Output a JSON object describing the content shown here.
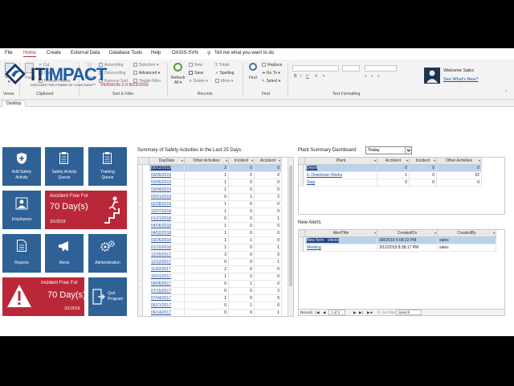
{
  "menu": {
    "file": "File",
    "home": "Home",
    "create": "Create",
    "external": "External Data",
    "database": "Database Tools",
    "help": "Help",
    "oasis": "OASIS-SVN",
    "tellme": "Tell me what you want to do"
  },
  "ribbon": {
    "view": "View",
    "paste": "Paste",
    "cut": "Cut",
    "copy": "Copy",
    "format_painter": "Format Painter",
    "filter": "Filter",
    "ascending": "Ascending",
    "descending": "Descending",
    "remove_sort": "Remove Sort",
    "selection": "Selection",
    "advanced": "Advanced",
    "toggle_filter": "Toggle Filter",
    "refresh": "Refresh",
    "refresh_all": "All",
    "new": "New",
    "save": "Save",
    "delete": "Delete",
    "totals": "Totals",
    "spelling": "Spelling",
    "more": "More",
    "find": "Find",
    "replace": "Replace",
    "goto": "Go To",
    "select": "Select",
    "groups": {
      "views": "Views",
      "clipboard": "Clipboard",
      "sort_filter": "Sort & Filter",
      "records": "Records",
      "find": "Find",
      "text_formatting": "Text Formatting"
    }
  },
  "tab": {
    "desktop": "Desktop"
  },
  "header": {
    "logo_it": "IT",
    "logo_impact": "IMPACT",
    "tagline": "DISCOVER THE POWER OF YOUR DATA™",
    "version": "VERSION 2.0 8/23/2016",
    "welcome": "Welcome Sales",
    "whats_new": "See What's New?"
  },
  "tiles": {
    "add_safety_1": "Add Safety",
    "add_safety_2": "Activity",
    "safety_queue_1": "Safety Activity",
    "safety_queue_2": "Queue",
    "training_1": "Training",
    "training_2": "Queue",
    "employees": "Employees",
    "reports": "Reports",
    "alerts": "Alerts",
    "administration": "Administration",
    "quit_1": "Quit",
    "quit_2": "Program",
    "accident_free_1": {
      "title": "Accident Free For",
      "days": "70 Day(s)",
      "date": "3/1/2019"
    },
    "accident_free_2": {
      "title": "Incident Free For",
      "days": "70 Day(s)",
      "date": "3/1/2019"
    }
  },
  "summary": {
    "title": "Summary of Safety Activities in the Last 25 Days:",
    "columns": [
      "DayDate",
      "Other Activities",
      "Incident",
      "Accident"
    ],
    "rows": [
      [
        "03/12/2019",
        "2",
        "0",
        "0"
      ],
      [
        "03/06/2019",
        "1",
        "0",
        "0"
      ],
      [
        "03/05/2019",
        "1",
        "0",
        "0"
      ],
      [
        "03/04/2019",
        "1",
        "0",
        "0"
      ],
      [
        "03/01/2019",
        "5",
        "1",
        "2"
      ],
      [
        "02/28/2019",
        "1",
        "0",
        "0"
      ],
      [
        "12/07/2018",
        "1",
        "0",
        "0"
      ],
      [
        "01/21/2018",
        "0",
        "0",
        "1"
      ],
      [
        "04/06/2018",
        "1",
        "0",
        "0"
      ],
      [
        "04/02/2018",
        "1",
        "0",
        "0"
      ],
      [
        "03/26/2018",
        "1",
        "1",
        "0"
      ],
      [
        "01/10/2018",
        "1",
        "0",
        "1"
      ],
      [
        "12/20/2017",
        "3",
        "0",
        "0"
      ],
      [
        "12/12/2017",
        "0",
        "0",
        "1"
      ],
      [
        "11/02/2017",
        "2",
        "0",
        "0"
      ],
      [
        "10/31/2017",
        "1",
        "0",
        "0"
      ],
      [
        "09/06/2017",
        "0",
        "1",
        "0"
      ],
      [
        "07/15/2017",
        "0",
        "0",
        "2"
      ],
      [
        "07/04/2017",
        "1",
        "0",
        "0"
      ],
      [
        "06/21/2017",
        "0",
        "1",
        "0"
      ],
      [
        "06/14/2017",
        "0",
        "0",
        "1"
      ]
    ]
  },
  "plant": {
    "title": "Plant Summary Dashboard:",
    "combo_value": "Today",
    "columns": [
      "Plant",
      "Accident",
      "Incident",
      "Other Activities"
    ],
    "rows": [
      [
        "Depot",
        "0",
        "0",
        "0"
      ],
      [
        "IL Downtown Works",
        "1",
        "0",
        "52"
      ],
      [
        "Stop",
        "0",
        "0",
        "0"
      ]
    ]
  },
  "alerts": {
    "title": "New Alerts",
    "columns": [
      "AlertTitle",
      "CreatedOn",
      "CreatedBy"
    ],
    "rows": [
      [
        "New form - clients",
        "3/8/2019 5:09:22 PM",
        "sales"
      ],
      [
        "Meeting",
        "3/12/2019 8:38:17 PM",
        "sales"
      ]
    ],
    "nav": {
      "record": "Record:",
      "position": "1 of 2",
      "no_filter": "No Filter",
      "search": "Search"
    }
  },
  "colors": {
    "tile_blue": "#2f6196",
    "tile_red": "#ba2738",
    "brand_navy": "#15365f",
    "brand_blue": "#1f5da4",
    "access_accent": "#a4373a"
  }
}
